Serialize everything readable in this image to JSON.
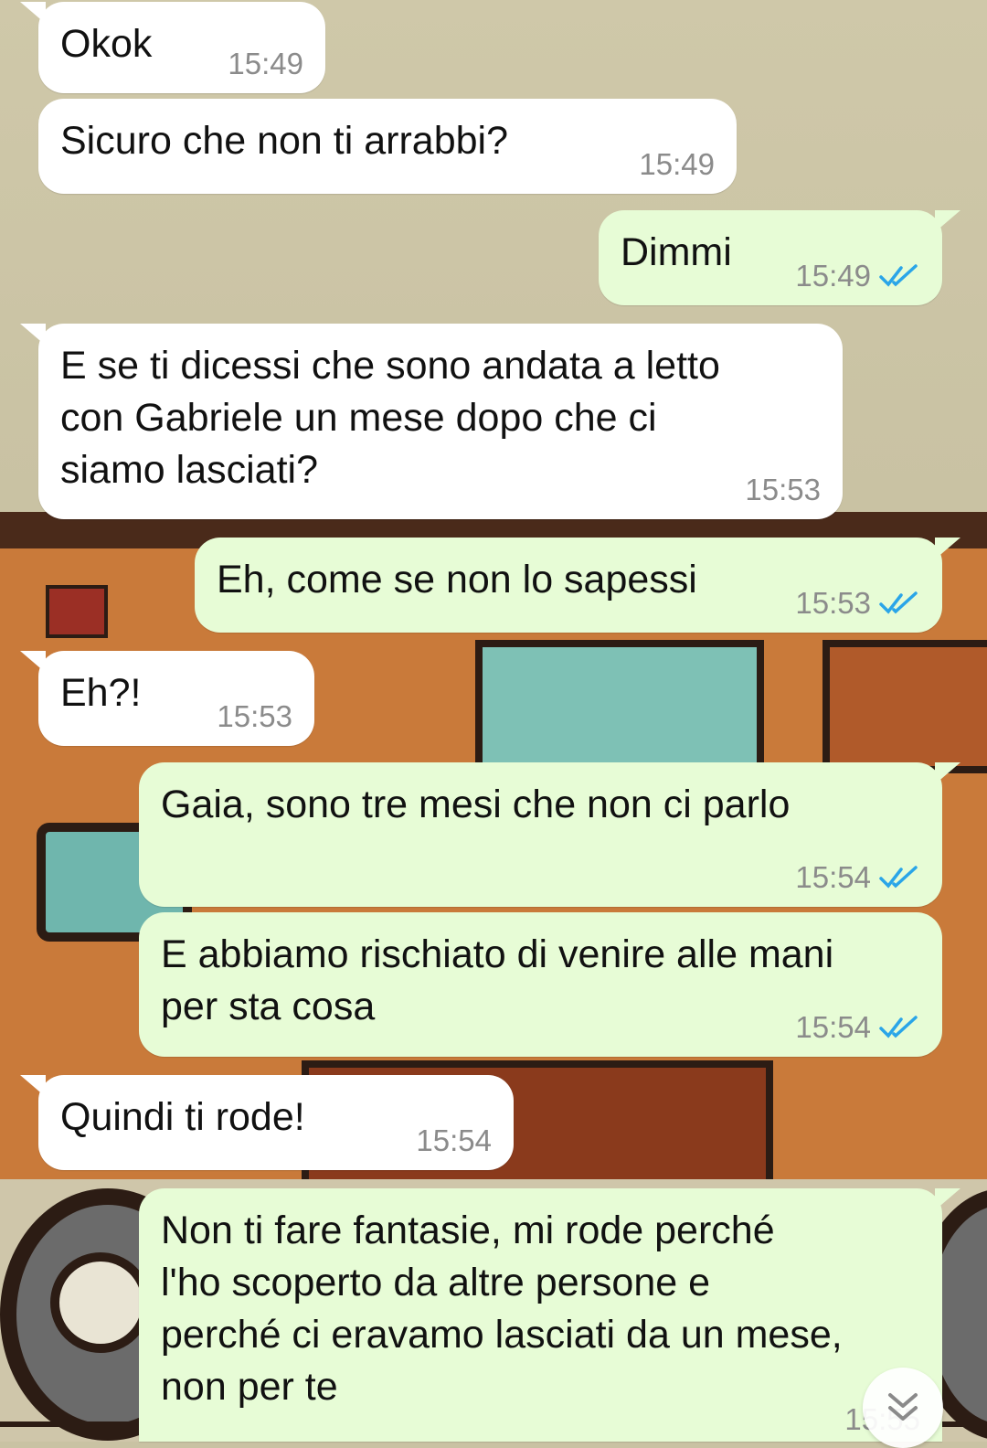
{
  "colors": {
    "incoming_bubble": "#ffffff",
    "outgoing_bubble": "#e7fcd6",
    "timestamp": "#8b8b8b",
    "read_ticks": "#2aa5e8"
  },
  "messages": [
    {
      "direction": "in",
      "text": "Okok",
      "time": "15:49"
    },
    {
      "direction": "in",
      "text": "Sicuro che non ti arrabbi?",
      "time": "15:49"
    },
    {
      "direction": "out",
      "text": "Dimmi",
      "time": "15:49",
      "status": "read"
    },
    {
      "direction": "in",
      "text": "E se ti dicessi che sono andata a letto\ncon Gabriele un mese dopo che ci\nsiamo lasciati?",
      "time": "15:53"
    },
    {
      "direction": "out",
      "text": "Eh, come se non lo sapessi",
      "time": "15:53",
      "status": "read"
    },
    {
      "direction": "in",
      "text": "Eh?!",
      "time": "15:53"
    },
    {
      "direction": "out",
      "text": "Gaia, sono tre mesi che non ci parlo",
      "time": "15:54",
      "status": "read"
    },
    {
      "direction": "out",
      "text": "E abbiamo rischiato di venire alle mani\nper sta cosa",
      "time": "15:54",
      "status": "read"
    },
    {
      "direction": "in",
      "text": "Quindi ti rode!",
      "time": "15:54"
    },
    {
      "direction": "out",
      "text": "Non ti fare fantasie, mi rode perché\nl'ho scoperto da altre persone e\nperché ci eravamo lasciati da un mese,\nnon per te",
      "time": "15:55",
      "status": "read"
    }
  ],
  "scroll_button_icon": "double-chevron-down-icon",
  "read_icon": "double-check-icon"
}
